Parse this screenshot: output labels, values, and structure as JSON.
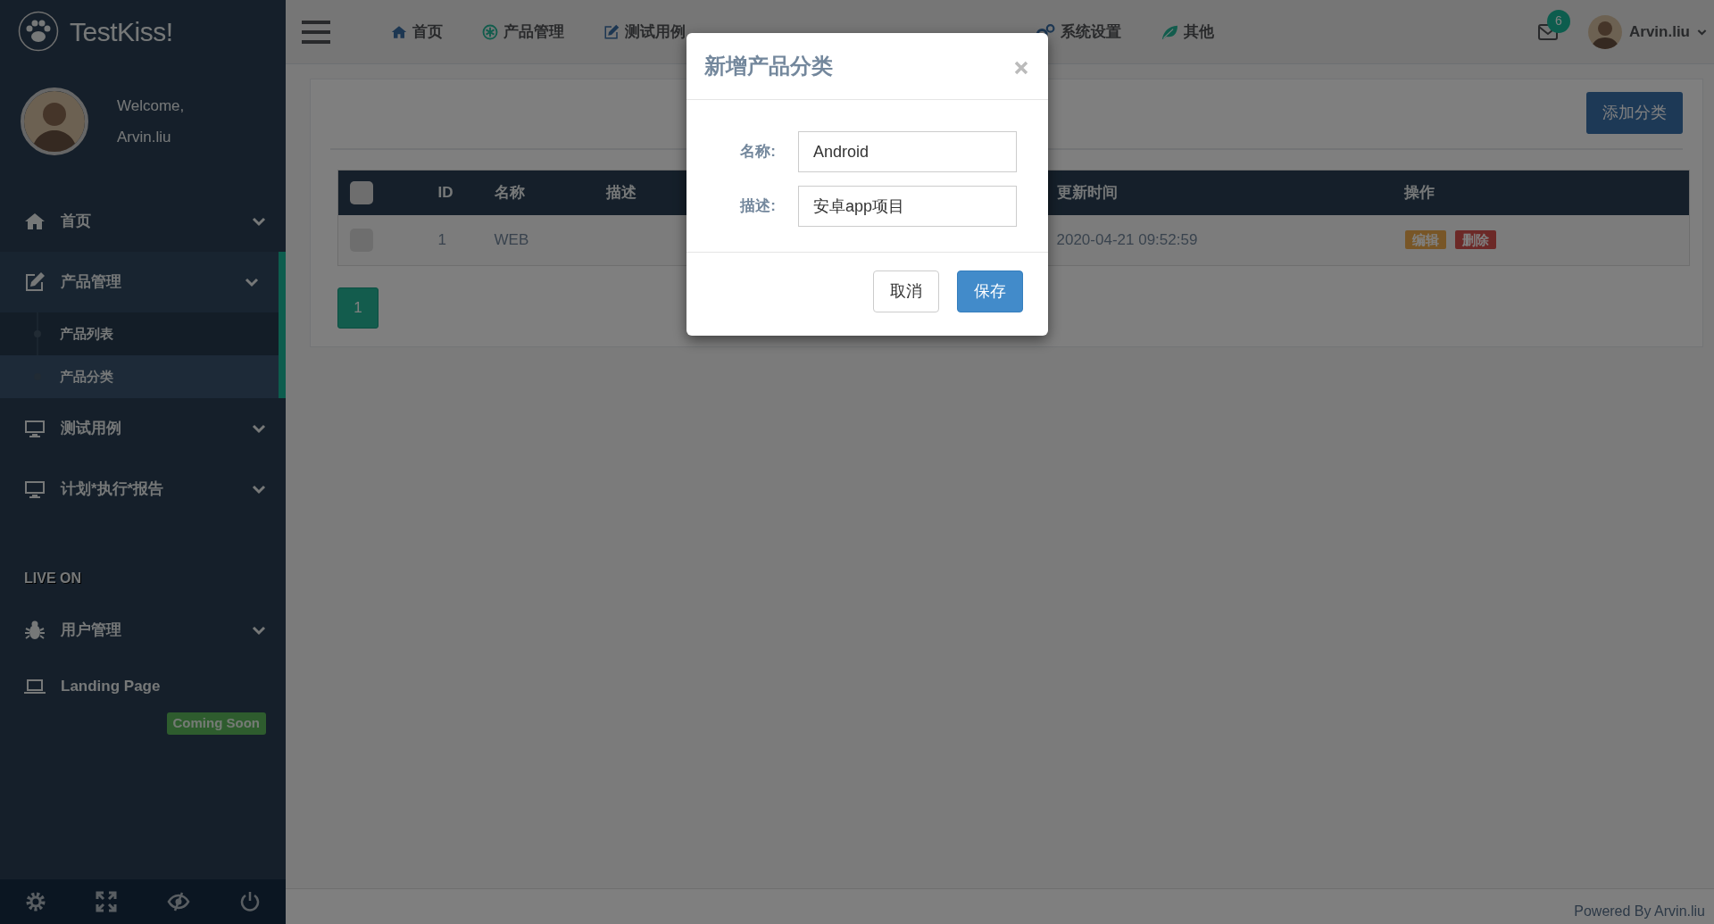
{
  "sidebar": {
    "brand": "TestKiss!",
    "welcome": "Welcome,",
    "user": "Arvin.liu",
    "menu": [
      {
        "label": "首页",
        "selected": false
      },
      {
        "label": "产品管理",
        "selected": true,
        "children": [
          {
            "label": "产品列表",
            "selected": false
          },
          {
            "label": "产品分类",
            "selected": true
          }
        ]
      },
      {
        "label": "测试用例",
        "selected": false
      },
      {
        "label": "计划*执行*报告",
        "selected": false
      }
    ],
    "section_title": "LIVE ON",
    "section_menu": [
      {
        "label": "用户管理",
        "kind": "dropdown"
      },
      {
        "label": "Landing Page",
        "kind": "link",
        "badge": "Coming Soon"
      }
    ]
  },
  "topnav": {
    "items": [
      {
        "label": "首页"
      },
      {
        "label": "产品管理"
      },
      {
        "label": "测试用例"
      },
      {
        "kind": "covered"
      },
      {
        "kind": "covered"
      },
      {
        "label": "系统设置"
      },
      {
        "label": "其他"
      }
    ],
    "mail_count": "6",
    "user": "Arvin.liu"
  },
  "page": {
    "add_button": "添加分类",
    "table": {
      "header_checked": false,
      "columns": [
        "ID",
        "名称",
        "描述",
        "更新时间",
        "操作"
      ],
      "rows": [
        {
          "checked": false,
          "id": "1",
          "name": "WEB",
          "updated": "2020-04-21 09:52:59",
          "actions": [
            {
              "label": "编辑",
              "kind": "edit"
            },
            {
              "label": "删除",
              "kind": "delete"
            }
          ]
        }
      ]
    },
    "pagination": [
      {
        "label": "1",
        "selected": true
      }
    ]
  },
  "modal": {
    "title": "新增产品分类",
    "fields": [
      {
        "label": "名称:",
        "value": "Android"
      },
      {
        "label": "描述:",
        "value": "安卓app项目"
      }
    ],
    "buttons": [
      {
        "label": "取消",
        "kind": "secondary"
      },
      {
        "label": "保存",
        "kind": "primary"
      }
    ]
  },
  "footer": "Powered By Arvin.liu"
}
